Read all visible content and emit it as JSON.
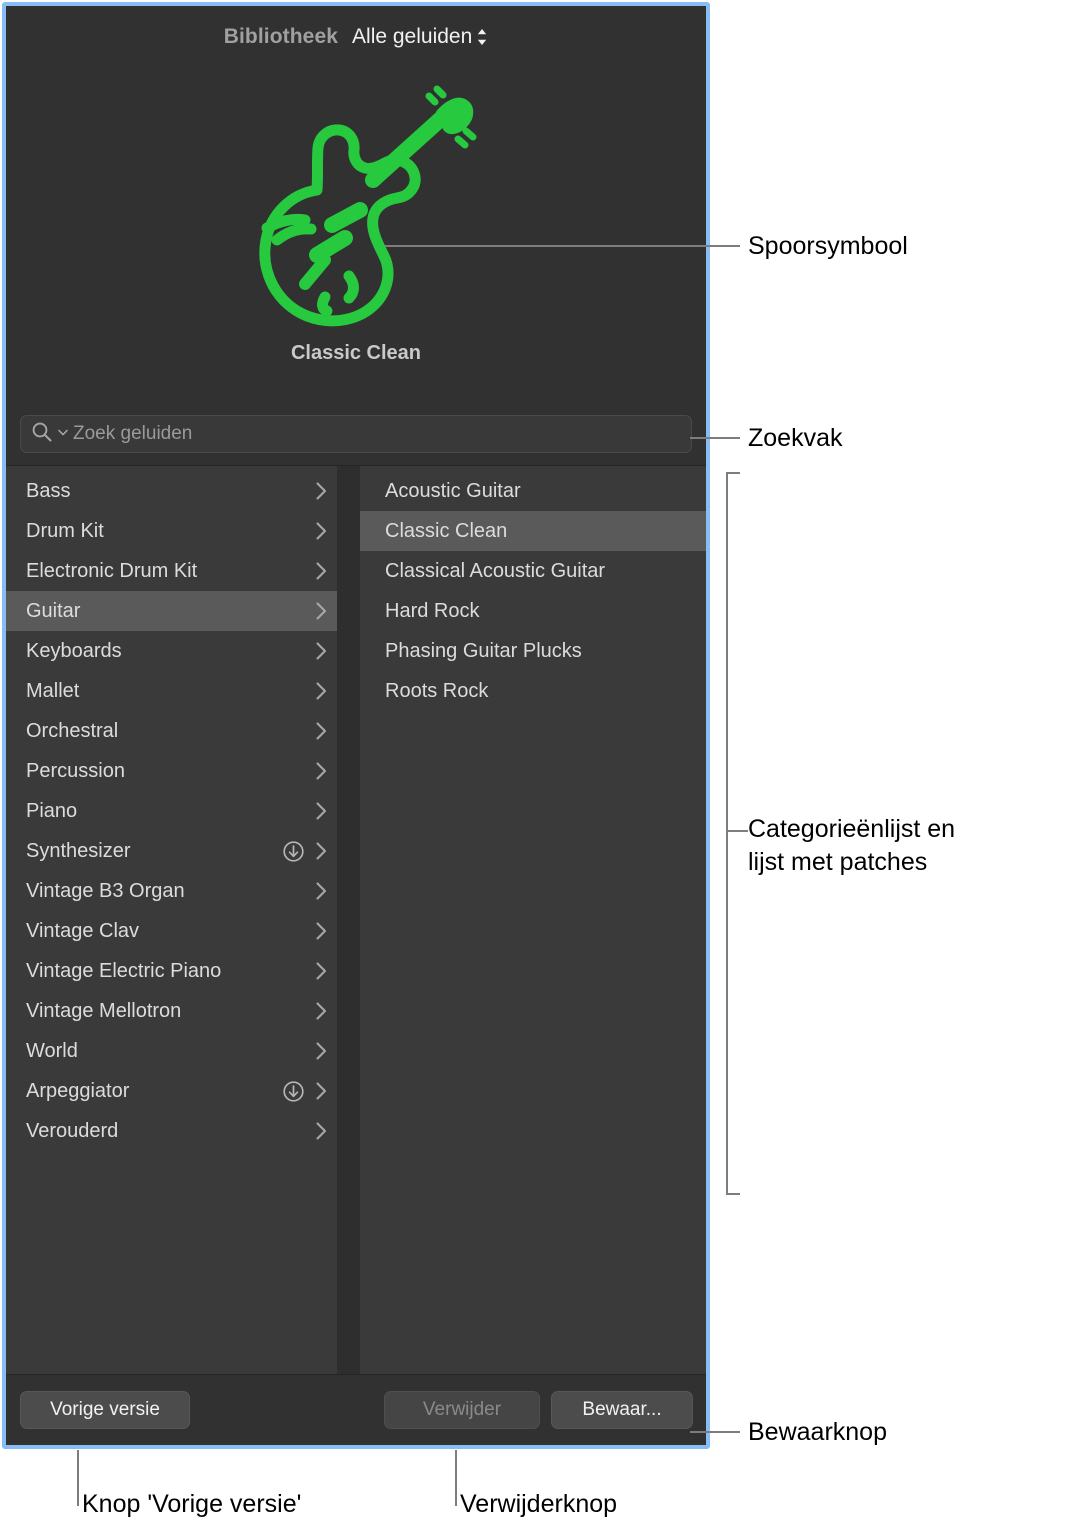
{
  "panel": {
    "header": {
      "title": "Bibliotheek",
      "popup_value": "Alle geluiden",
      "popup_icon": "chevron-up-down-icon"
    },
    "artwork": {
      "icon": "electric-guitar-icon",
      "icon_color": "#27c93f",
      "patch_name": "Classic Clean"
    },
    "search": {
      "icon": "search-icon",
      "dropdown_icon": "chevron-down-icon",
      "placeholder": "Zoek geluiden",
      "value": ""
    },
    "categories": [
      {
        "label": "Bass",
        "selected": false,
        "download": false
      },
      {
        "label": "Drum Kit",
        "selected": false,
        "download": false
      },
      {
        "label": "Electronic Drum Kit",
        "selected": false,
        "download": false
      },
      {
        "label": "Guitar",
        "selected": true,
        "download": false
      },
      {
        "label": "Keyboards",
        "selected": false,
        "download": false
      },
      {
        "label": "Mallet",
        "selected": false,
        "download": false
      },
      {
        "label": "Orchestral",
        "selected": false,
        "download": false
      },
      {
        "label": "Percussion",
        "selected": false,
        "download": false
      },
      {
        "label": "Piano",
        "selected": false,
        "download": false
      },
      {
        "label": "Synthesizer",
        "selected": false,
        "download": true
      },
      {
        "label": "Vintage B3 Organ",
        "selected": false,
        "download": false
      },
      {
        "label": "Vintage Clav",
        "selected": false,
        "download": false
      },
      {
        "label": "Vintage Electric Piano",
        "selected": false,
        "download": false
      },
      {
        "label": "Vintage Mellotron",
        "selected": false,
        "download": false
      },
      {
        "label": "World",
        "selected": false,
        "download": false
      },
      {
        "label": "Arpeggiator",
        "selected": false,
        "download": true
      },
      {
        "label": "Verouderd",
        "selected": false,
        "download": false
      }
    ],
    "patches": [
      {
        "label": "Acoustic Guitar",
        "selected": false
      },
      {
        "label": "Classic Clean",
        "selected": true
      },
      {
        "label": "Classical Acoustic Guitar",
        "selected": false
      },
      {
        "label": "Hard Rock",
        "selected": false
      },
      {
        "label": "Phasing Guitar Plucks",
        "selected": false
      },
      {
        "label": "Roots Rock",
        "selected": false
      }
    ],
    "footer": {
      "previous_label": "Vorige versie",
      "delete_label": "Verwijder",
      "save_label": "Bewaar..."
    }
  },
  "callouts": {
    "track_symbol": "Spoorsymbool",
    "search_box": "Zoekvak",
    "category_and_patch_list": "Categorieënlijst en\nlijst met patches",
    "save_button": "Bewaarknop",
    "previous_version_button": "Knop 'Vorige versie'",
    "delete_button": "Verwijderknop"
  }
}
